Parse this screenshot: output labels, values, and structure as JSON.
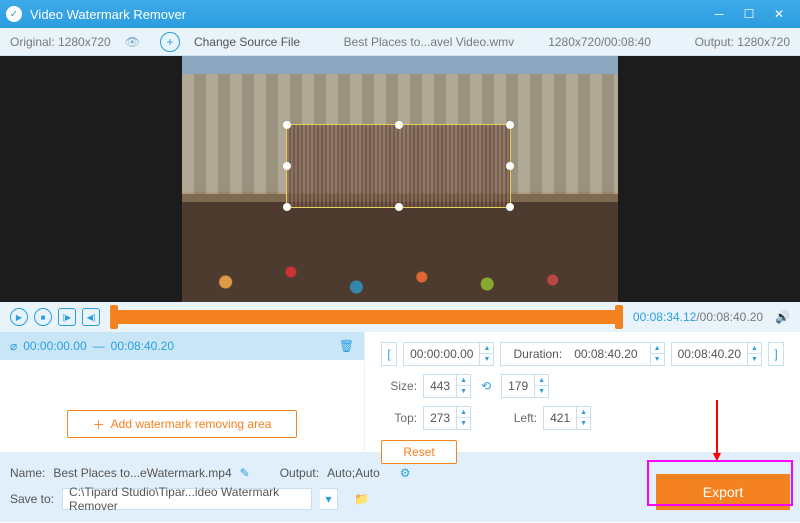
{
  "app": {
    "title": "Video Watermark Remover"
  },
  "toolbar": {
    "original": "Original: 1280x720",
    "change": "Change Source File",
    "filename": "Best Places to...avel Video.wmv",
    "fileinfo": "1280x720/00:08:40",
    "output": "Output: 1280x720"
  },
  "playback": {
    "current": "00:08:34.12",
    "total": "/00:08:40.20"
  },
  "segment": {
    "start": "00:00:00.00",
    "sep": "—",
    "end": "00:08:40.20"
  },
  "addarea": "Add watermark removing area",
  "trim": {
    "start": "00:00:00.00",
    "durlabel": "Duration:",
    "durval": "00:08:40.20",
    "end": "00:08:40.20"
  },
  "size": {
    "label": "Size:",
    "w": "443",
    "h": "179"
  },
  "pos": {
    "toplabel": "Top:",
    "top": "273",
    "leftlabel": "Left:",
    "left": "421"
  },
  "reset": "Reset",
  "name": {
    "label": "Name:",
    "value": "Best Places to...eWatermark.mp4"
  },
  "output": {
    "label": "Output:",
    "value": "Auto;Auto"
  },
  "saveto": {
    "label": "Save to:",
    "value": "C:\\Tipard Studio\\Tipar...ideo Watermark Remover"
  },
  "export": "Export"
}
